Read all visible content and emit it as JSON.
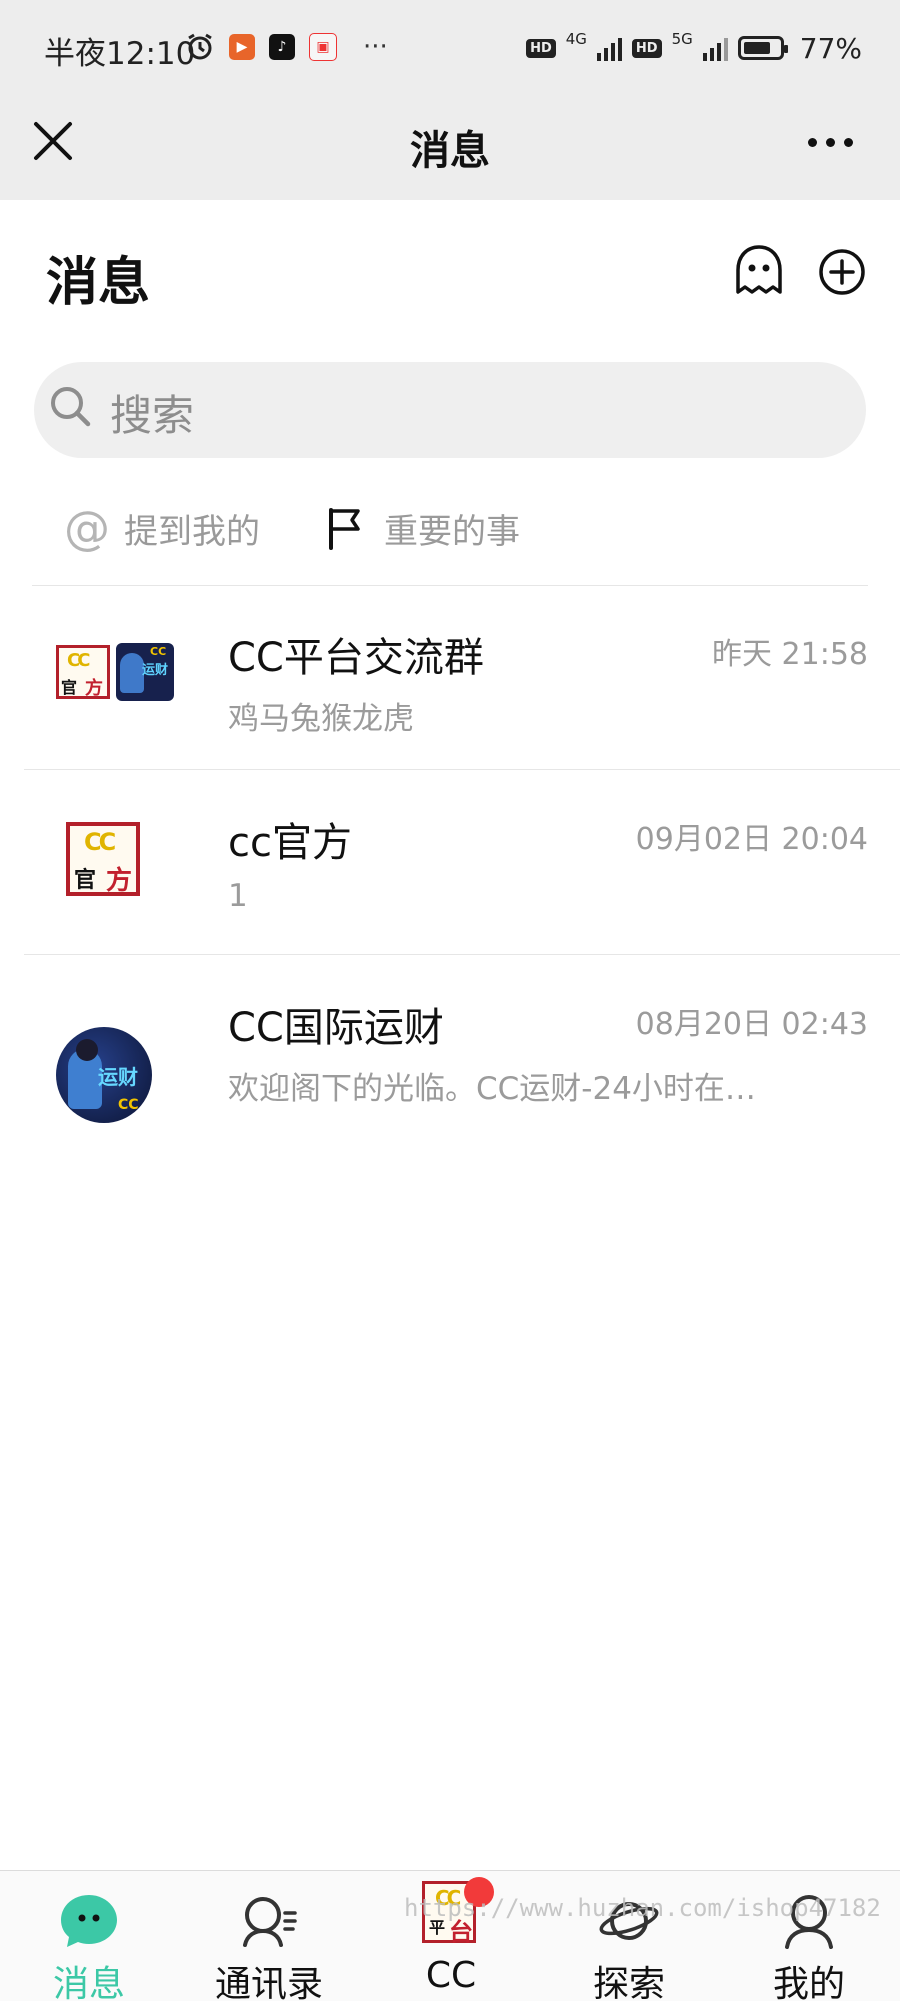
{
  "status_bar": {
    "time": "半夜12:10",
    "more_indicator": "···",
    "network_1": "4G",
    "network_2": "5G",
    "hd_label": "HD",
    "battery_text": "77%",
    "battery_level": 0.77,
    "icons": [
      "alarm-icon",
      "video-app-icon",
      "tiktok-icon",
      "xiaohongshu-icon"
    ]
  },
  "title_bar": {
    "title": "消息",
    "close_icon": "close-icon",
    "more_icon": "more-icon"
  },
  "header": {
    "title": "消息",
    "ghost_icon": "ghost-icon",
    "add_icon": "plus-circle-icon"
  },
  "search": {
    "placeholder": "搜索"
  },
  "filters": [
    {
      "icon": "at-icon",
      "glyph": "@",
      "label": "提到我的"
    },
    {
      "icon": "flag-icon",
      "label": "重要的事"
    }
  ],
  "conversations": [
    {
      "name": "CC平台交流群",
      "time": "昨天 21:58",
      "preview": "鸡马兔猴龙虎",
      "avatar": "group-avatar"
    },
    {
      "name": "cc官方",
      "time": "09月02日 20:04",
      "preview": "1",
      "avatar": "official-stamp-avatar"
    },
    {
      "name": "CC国际运财",
      "time": "08月20日 02:43",
      "preview": "欢迎阁下的光临。CC运财-24小时在…",
      "avatar": "yuncai-avatar"
    }
  ],
  "avatar_text": {
    "cc_logo": "CC",
    "guan": "官",
    "fang": "方",
    "yuncai": "运财",
    "ping": "平",
    "tai": "台"
  },
  "tab_bar": {
    "tabs": [
      {
        "label": "消息",
        "icon": "chat-bubble-icon",
        "active": true
      },
      {
        "label": "通讯录",
        "icon": "contacts-icon",
        "active": false
      },
      {
        "label": "CC",
        "icon": "cc-platform-icon",
        "active": false,
        "badge": true
      },
      {
        "label": "探索",
        "icon": "explore-planet-icon",
        "active": false
      },
      {
        "label": "我的",
        "icon": "profile-icon",
        "active": false
      }
    ]
  },
  "watermark": "https://www.huzhan.com/ishop47182",
  "colors": {
    "accent": "#3cc8a6",
    "stamp_red": "#c2202e",
    "badge_red": "#f23a3a",
    "bar_gray": "#ededed"
  }
}
